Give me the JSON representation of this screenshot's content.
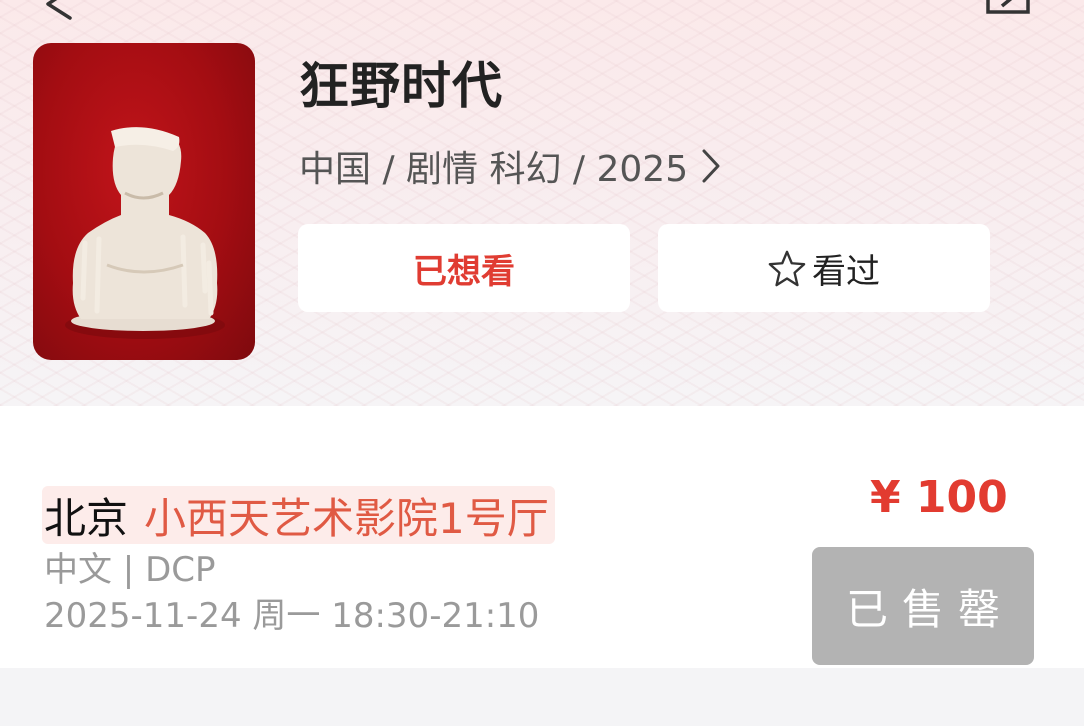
{
  "movie": {
    "title": "狂野时代",
    "meta": "中国 / 剧情 科幻 / 2025",
    "want_button": "已想看",
    "seen_button": "看过"
  },
  "showing": {
    "city": "北京",
    "hall": "小西天艺术影院1号厅",
    "format": "中文 | DCP",
    "time": "2025-11-24 周一 18:30-21:10",
    "price": "¥ 100",
    "status_button": "已售罄"
  },
  "icons": {
    "back": "back-arrow-icon",
    "share": "share-icon",
    "meta_more": "chevron-right-icon",
    "seen": "star-outline-icon"
  },
  "colors": {
    "accent_red": "#e23b30",
    "soldout_gray": "#b3b3b3"
  }
}
